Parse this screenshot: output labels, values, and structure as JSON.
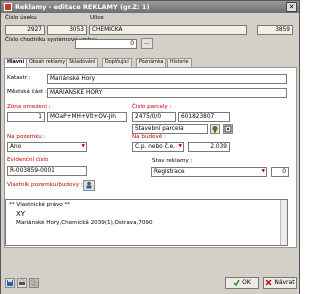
{
  "window": {
    "title": "Reklamy - editace REKLAMY (gr.Z: 1)",
    "close_glyph": "✕"
  },
  "header": {
    "cislo_useku_label": "Číslo úseku",
    "ulice_label": "Ulice",
    "cislo_useku_1": "2927",
    "cislo_useku_2": "3053",
    "ulice_value": "CHEMICKÁ",
    "ulice_code": "3859",
    "chodnik_label": "Číslo chodníku systémové vrstvy",
    "chodnik_value": "0",
    "chodnik_btn": "..."
  },
  "tabs": [
    "Hlavní",
    "Obsah reklamy",
    "Skladování",
    "Doplňující",
    "Poznámka",
    "Historie"
  ],
  "main": {
    "katastr_label": "Katastr :",
    "katastr_value": "Mariánské Hory",
    "mestska_label": "Městská část :",
    "mestska_value": "MARIÁNSKÉ HORY",
    "zona_label": "Zóna omezení :",
    "zona_num": "1",
    "zona_value": "MOaP+MH+Vít+OV-Jih",
    "parcela_label": "Číslo parcely :",
    "parcela_value": "2475/0/0",
    "parcela_code": "601823807",
    "parcela_type": "Stavební parcela",
    "pozemku_label": "Na pozemku :",
    "pozemku_value": "Ano",
    "budove_label": "Na budově :",
    "budove_value": "Č.p. nebo č.e.",
    "budove_num": "2.039",
    "evidencni_label": "Evidenční číslo",
    "evidencni_value": "R-003859-0001",
    "stav_label": "Stav reklamy :",
    "stav_value": "Registrace",
    "stav_num": "0",
    "vlastnik_label": "Vlastník pozemku/budovy :",
    "memo_header": "** Vlastnické právo **",
    "memo_line1": "XY",
    "memo_line2": "Mariánské Hory,Chemická 2039(1),Ostrava,7090"
  },
  "buttons": {
    "ok": "OK",
    "cancel": "Návrat"
  }
}
